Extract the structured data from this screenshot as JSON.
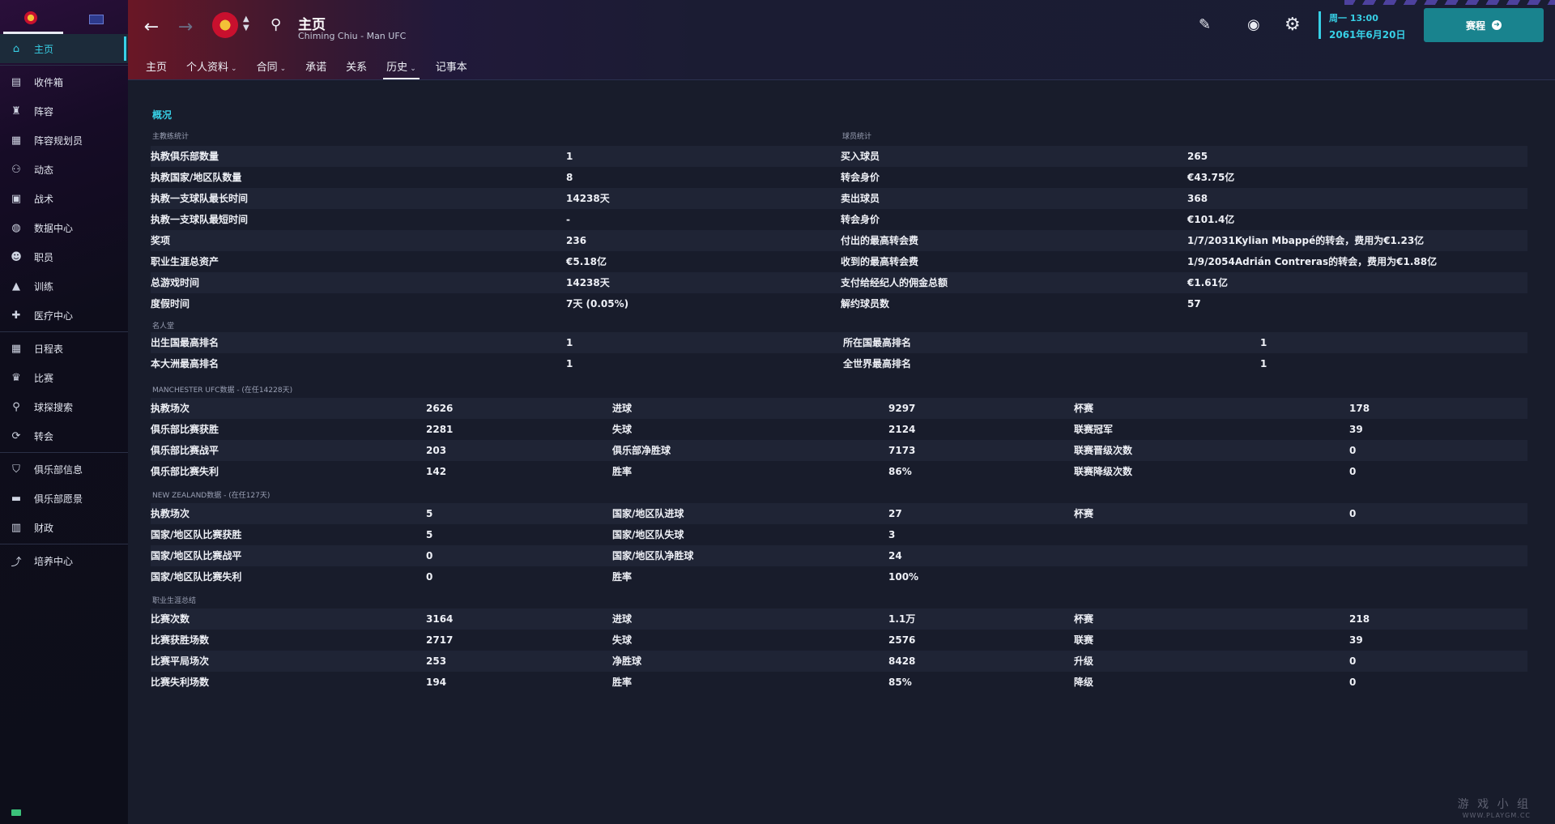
{
  "sidebar": {
    "items": [
      {
        "label": "主页",
        "icon": "home-icon",
        "glyph": "⌂",
        "active": true
      },
      {
        "label": "收件箱",
        "icon": "inbox-icon",
        "glyph": "▤"
      },
      {
        "label": "阵容",
        "icon": "squad-shirt-icon",
        "glyph": "♜"
      },
      {
        "label": "阵容规划员",
        "icon": "clipboard-icon",
        "glyph": "▦"
      },
      {
        "label": "动态",
        "icon": "dynamics-icon",
        "glyph": "⚇"
      },
      {
        "label": "战术",
        "icon": "tactics-icon",
        "glyph": "▣"
      },
      {
        "label": "数据中心",
        "icon": "data-hub-icon",
        "glyph": "◍"
      },
      {
        "label": "职员",
        "icon": "staff-icon",
        "glyph": "☻"
      },
      {
        "label": "训练",
        "icon": "training-icon",
        "glyph": "▲"
      },
      {
        "label": "医疗中心",
        "icon": "medical-icon",
        "glyph": "✚"
      },
      {
        "label": "日程表",
        "icon": "calendar-icon",
        "glyph": "▦"
      },
      {
        "label": "比赛",
        "icon": "trophy-icon",
        "glyph": "♛"
      },
      {
        "label": "球探搜索",
        "icon": "search-icon",
        "glyph": "⚲"
      },
      {
        "label": "转会",
        "icon": "transfer-icon",
        "glyph": "⟳"
      },
      {
        "label": "俱乐部信息",
        "icon": "shield-icon",
        "glyph": "⛉"
      },
      {
        "label": "俱乐部愿景",
        "icon": "briefcase-icon",
        "glyph": "▬"
      },
      {
        "label": "财政",
        "icon": "finance-icon",
        "glyph": "▥"
      },
      {
        "label": "培养中心",
        "icon": "development-icon",
        "glyph": "⤴"
      }
    ]
  },
  "header": {
    "title": "主页",
    "subtitle": "Chiming Chiu - Man UFC",
    "tabs": [
      {
        "label": "主页",
        "dropdown": false
      },
      {
        "label": "个人资料",
        "dropdown": true
      },
      {
        "label": "合同",
        "dropdown": true
      },
      {
        "label": "承诺",
        "dropdown": false
      },
      {
        "label": "关系",
        "dropdown": false
      },
      {
        "label": "历史",
        "dropdown": true,
        "active": true
      },
      {
        "label": "记事本",
        "dropdown": false
      }
    ],
    "day_time": "周一 13:00",
    "date": "2061年6月20日",
    "continue_label": "赛程"
  },
  "content": {
    "section_title": "概况",
    "manager_stats_label": "主教练统计",
    "player_stats_label": "球员统计",
    "manager_stats": [
      {
        "label": "执教俱乐部数量",
        "value": "1"
      },
      {
        "label": "执教国家/地区队数量",
        "value": "8"
      },
      {
        "label": "执教一支球队最长时间",
        "value": "14238天"
      },
      {
        "label": "执教一支球队最短时间",
        "value": "-"
      },
      {
        "label": "奖项",
        "value": "236"
      },
      {
        "label": "职业生涯总资产",
        "value": "€5.18亿"
      },
      {
        "label": "总游戏时间",
        "value": "14238天"
      },
      {
        "label": "度假时间",
        "value": "7天 (0.05%)"
      }
    ],
    "player_stats": [
      {
        "label": "买入球员",
        "value": "265"
      },
      {
        "label": "转会身价",
        "value": "€43.75亿"
      },
      {
        "label": "卖出球员",
        "value": "368"
      },
      {
        "label": "转会身价",
        "value": "€101.4亿"
      },
      {
        "label": "付出的最高转会费",
        "value": "1/7/2031Kylian Mbappé的转会，费用为€1.23亿"
      },
      {
        "label": "收到的最高转会费",
        "value": "1/9/2054Adrián Contreras的转会，费用为€1.88亿"
      },
      {
        "label": "支付给经纪人的佣金总额",
        "value": "€1.61亿"
      },
      {
        "label": "解约球员数",
        "value": "57"
      }
    ],
    "hall_of_fame_label": "名人堂",
    "hall_of_fame": [
      {
        "l1": "出生国最高排名",
        "v1": "1",
        "l2": "所在国最高排名",
        "v2": "1"
      },
      {
        "l1": "本大洲最高排名",
        "v1": "1",
        "l2": "全世界最高排名",
        "v2": "1"
      }
    ],
    "club_label": "MANCHESTER UFC数据 - (在任14228天)",
    "club_rows": [
      {
        "l1": "执教场次",
        "v1": "2626",
        "l2": "进球",
        "v2": "9297",
        "l3": "杯赛",
        "v3": "178"
      },
      {
        "l1": "俱乐部比赛获胜",
        "v1": "2281",
        "l2": "失球",
        "v2": "2124",
        "l3": "联赛冠军",
        "v3": "39"
      },
      {
        "l1": "俱乐部比赛战平",
        "v1": "203",
        "l2": "俱乐部净胜球",
        "v2": "7173",
        "l3": "联赛晋级次数",
        "v3": "0"
      },
      {
        "l1": "俱乐部比赛失利",
        "v1": "142",
        "l2": "胜率",
        "v2": "86%",
        "l3": "联赛降级次数",
        "v3": "0"
      }
    ],
    "nation_label": "NEW ZEALAND数据 - (在任127天)",
    "nation_rows": [
      {
        "l1": "执教场次",
        "v1": "5",
        "l2": "国家/地区队进球",
        "v2": "27",
        "l3": "杯赛",
        "v3": "0"
      },
      {
        "l1": "国家/地区队比赛获胜",
        "v1": "5",
        "l2": "国家/地区队失球",
        "v2": "3",
        "l3": "",
        "v3": ""
      },
      {
        "l1": "国家/地区队比赛战平",
        "v1": "0",
        "l2": "国家/地区队净胜球",
        "v2": "24",
        "l3": "",
        "v3": ""
      },
      {
        "l1": "国家/地区队比赛失利",
        "v1": "0",
        "l2": "胜率",
        "v2": "100%",
        "l3": "",
        "v3": ""
      }
    ],
    "career_label": "职业生涯总结",
    "career_rows": [
      {
        "l1": "比赛次数",
        "v1": "3164",
        "l2": "进球",
        "v2": "1.1万",
        "l3": "杯赛",
        "v3": "218"
      },
      {
        "l1": "比赛获胜场数",
        "v1": "2717",
        "l2": "失球",
        "v2": "2576",
        "l3": "联赛",
        "v3": "39"
      },
      {
        "l1": "比赛平局场次",
        "v1": "253",
        "l2": "净胜球",
        "v2": "8428",
        "l3": "升级",
        "v3": "0"
      },
      {
        "l1": "比赛失利场数",
        "v1": "194",
        "l2": "胜率",
        "v2": "85%",
        "l3": "降级",
        "v3": "0"
      }
    ]
  },
  "watermark": {
    "text": "游 戏 小 组",
    "url": "WWW.PLAYGM.CC"
  }
}
